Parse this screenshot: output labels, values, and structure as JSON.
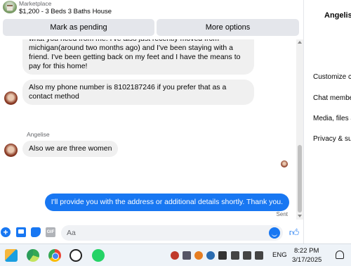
{
  "header": {
    "marketplace_label": "Marketplace",
    "listing_title": "$1,200 - 3 Beds 3 Baths House",
    "mark_pending_label": "Mark as pending",
    "more_options_label": "More options"
  },
  "messages": {
    "partial_text": "what you need from me. I've also just recently moved from michigan(around two months ago) and I've been staying with a friend. I've been getting back on my feet and I have the means to pay for this home!",
    "phone_text": "Also my phone number is 8102187246 if you prefer that as a contact method",
    "sender_name": "Angelise",
    "women_text": "Also we are three women",
    "outgoing_text": "I'll provide you with the address or additional details shortly. Thank you.",
    "sent_status": "Sent"
  },
  "composer": {
    "placeholder": "Aa",
    "gif_label": "GIF"
  },
  "right_panel": {
    "contact_name": "Angelise",
    "items": [
      "Customize chat",
      "Chat members",
      "Media, files and links",
      "Privacy & support"
    ]
  },
  "taskbar": {
    "language": "ENG",
    "time": "8:22 PM",
    "date": "3/17/2025"
  },
  "colors": {
    "accent": "#1877f2",
    "incoming_bubble": "#f0f0f0",
    "button_bg": "#e4e6eb"
  }
}
